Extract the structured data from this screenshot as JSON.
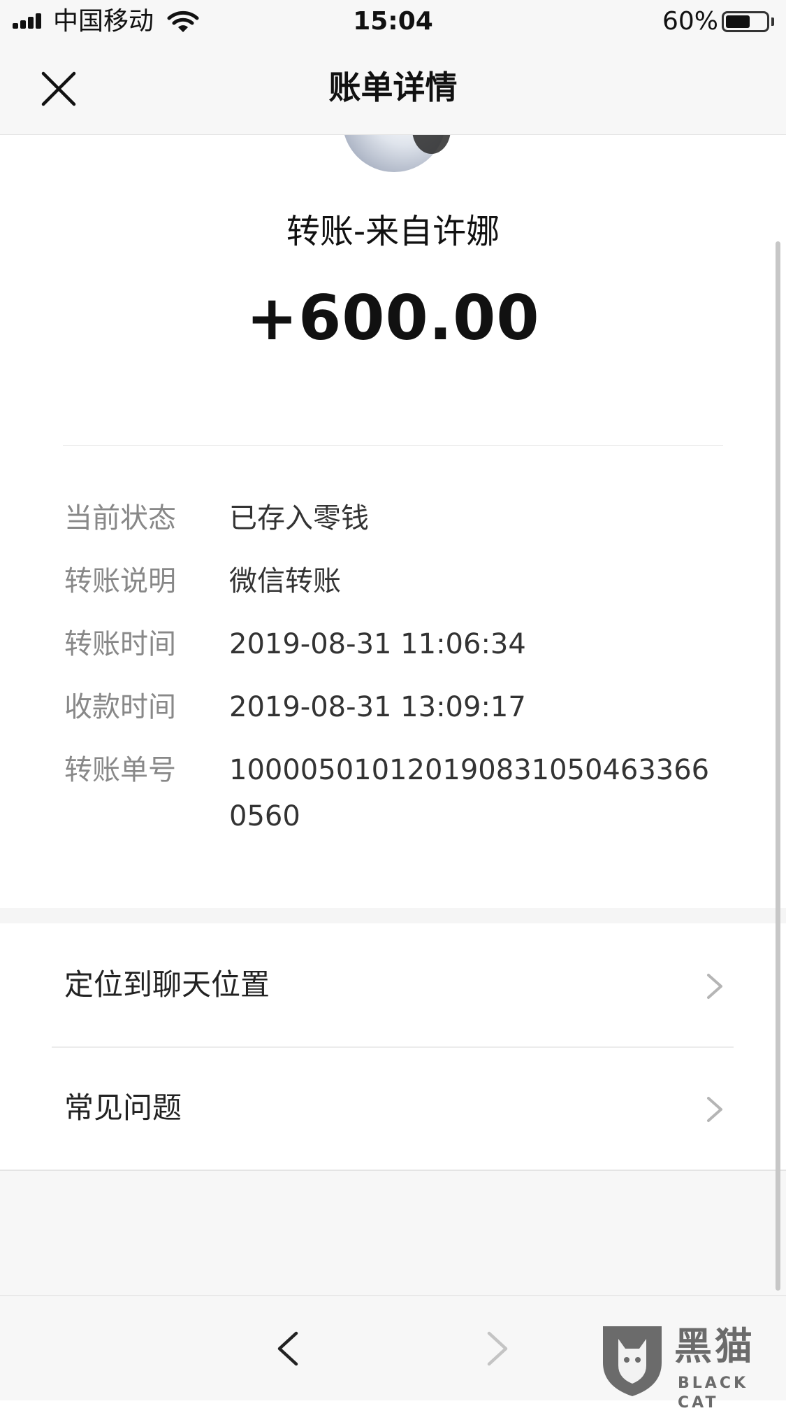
{
  "status_bar": {
    "carrier": "中国移动",
    "time": "15:04",
    "battery_percent": "60%",
    "battery_level": 0.6,
    "icons": [
      "signal-icon",
      "wifi-icon",
      "battery-icon"
    ]
  },
  "nav": {
    "title": "账单详情",
    "close_icon": "close-icon"
  },
  "transfer": {
    "sender_line": "转账-来自许娜",
    "amount": "+600.00"
  },
  "details": [
    {
      "label": "当前状态",
      "value": "已存入零钱"
    },
    {
      "label": "转账说明",
      "value": "微信转账"
    },
    {
      "label": "转账时间",
      "value": "2019-08-31 11:06:34"
    },
    {
      "label": "收款时间",
      "value": "2019-08-31 13:09:17"
    },
    {
      "label": "转账单号",
      "value": "100005010120190831050463366 0560"
    }
  ],
  "actions": [
    {
      "label": "定位到聊天位置",
      "icon": "chevron-right-icon"
    },
    {
      "label": "常见问题",
      "icon": "chevron-right-icon"
    }
  ],
  "toolbar": {
    "back_icon": "chevron-left-icon",
    "forward_icon": "chevron-right-icon"
  },
  "watermark": {
    "title": "黑猫",
    "subtitle": "BLACK CAT",
    "icon": "black-cat-logo-icon"
  },
  "colors": {
    "label_gray": "#888888",
    "value_text": "#333333",
    "bar_bg": "#f7f7f7",
    "divider": "#e5e5e5"
  }
}
